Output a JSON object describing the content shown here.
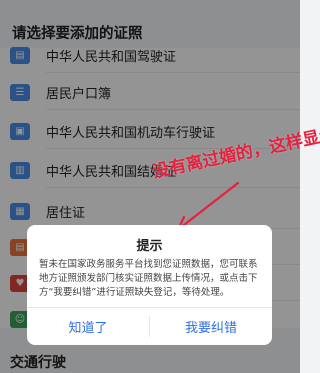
{
  "header": {
    "title": "请选择要添加的证照"
  },
  "list": {
    "items": [
      {
        "label": "中华人民共和国驾驶证",
        "icon": "id-card-icon",
        "color": "#4a8de8"
      },
      {
        "label": "居民户口簿",
        "icon": "household-book-icon",
        "color": "#4a8de8"
      },
      {
        "label": "中华人民共和国机动车行驶证",
        "icon": "vehicle-license-icon",
        "color": "#4a8de8"
      },
      {
        "label": "中华人民共和国结婚证",
        "icon": "marriage-certificate-icon",
        "color": "#4a8de8"
      },
      {
        "label": "居住证",
        "icon": "residence-permit-icon",
        "color": "#4a8de8"
      },
      {
        "label": "",
        "icon": "document-icon",
        "color": "#e8743b"
      },
      {
        "label": "",
        "icon": "heart-icon",
        "color": "#e0463f"
      },
      {
        "label": "",
        "icon": "people-icon",
        "color": "#3aa65a"
      }
    ]
  },
  "bottom_section": {
    "title": "交通行驶"
  },
  "annotation": {
    "text": "没有离过婚的，这样显示",
    "color": "#e4223f"
  },
  "dialog": {
    "title": "提示",
    "body": "暂未在国家政务服务平台找到您证照数据，您可联系地方证照颁发部门核实证照数据上传情况，或点击下方“我要纠错”进行证照缺失登记，等待处理。",
    "cancel_label": "知道了",
    "confirm_label": "我要纠错",
    "button_color": "#2f6fe0"
  }
}
